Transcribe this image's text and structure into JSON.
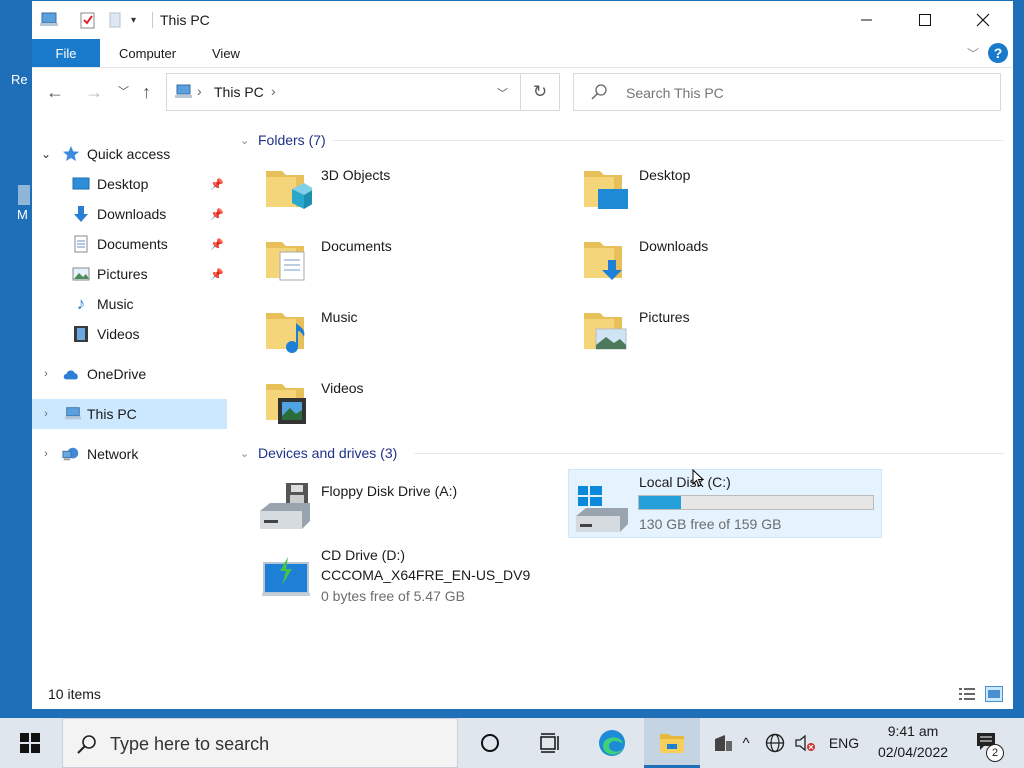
{
  "desktop": {
    "frag1": "Re",
    "frag2": "M"
  },
  "window": {
    "title": "This PC",
    "ribbon": {
      "file": "File",
      "computer": "Computer",
      "view": "View",
      "help": "?"
    },
    "address": {
      "path": "This PC"
    },
    "search": {
      "placeholder": "Search This PC"
    }
  },
  "nav": {
    "quick_access": "Quick access",
    "items": [
      {
        "label": "Desktop"
      },
      {
        "label": "Downloads"
      },
      {
        "label": "Documents"
      },
      {
        "label": "Pictures"
      },
      {
        "label": "Music"
      },
      {
        "label": "Videos"
      }
    ],
    "onedrive": "OneDrive",
    "this_pc": "This PC",
    "network": "Network"
  },
  "content": {
    "folders_header": "Folders (7)",
    "folders": [
      {
        "name": "3D Objects"
      },
      {
        "name": "Desktop"
      },
      {
        "name": "Documents"
      },
      {
        "name": "Downloads"
      },
      {
        "name": "Music"
      },
      {
        "name": "Pictures"
      },
      {
        "name": "Videos"
      }
    ],
    "drives_header": "Devices and drives (3)",
    "drives": {
      "floppy": {
        "name": "Floppy Disk Drive (A:)"
      },
      "local": {
        "name": "Local Disk (C:)",
        "free": "130 GB free of 159 GB",
        "used_fraction": 0.18
      },
      "cd": {
        "name": "CD Drive (D:)",
        "volume": "CCCOMA_X64FRE_EN-US_DV9",
        "free": "0 bytes free of 5.47 GB"
      }
    }
  },
  "status": {
    "items": "10 items"
  },
  "taskbar": {
    "search_placeholder": "Type here to search",
    "lang": "ENG",
    "time": "9:41 am",
    "date": "02/04/2022",
    "notifications": "2"
  },
  "colors": {
    "accent": "#1979ca",
    "selection": "#cce8ff",
    "group_header": "#1e3287"
  }
}
